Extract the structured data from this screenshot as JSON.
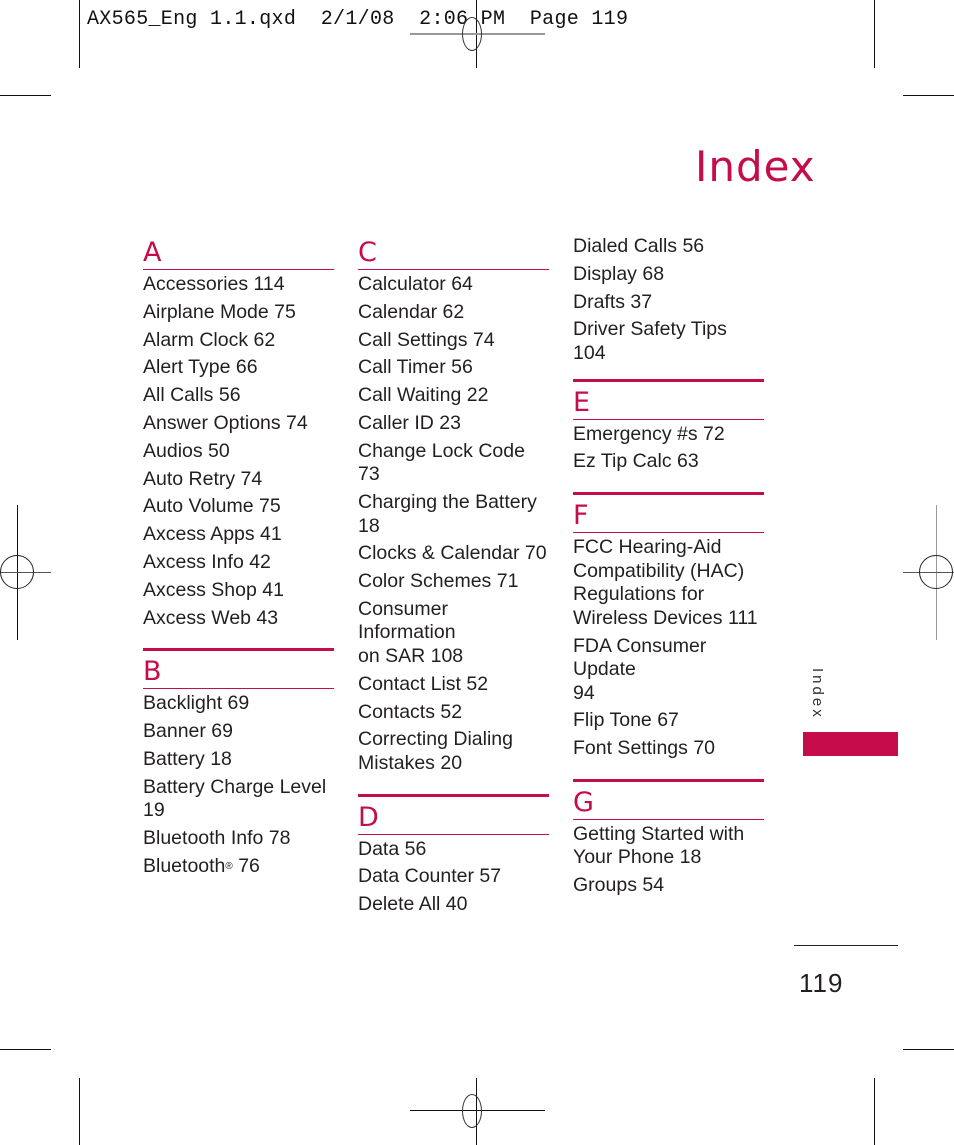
{
  "slug_line": "AX565_Eng 1.1.qxd  2/1/08  2:06 PM  Page 119",
  "title": "Index",
  "side_tab_label": "Index",
  "page_number": "119",
  "accent_color": "#c50d4c",
  "columns": [
    {
      "sections": [
        {
          "letter": "A",
          "entries": [
            "Accessories 114",
            "Airplane Mode 75",
            "Alarm Clock 62",
            "Alert Type 66",
            "All Calls 56",
            "Answer Options 74",
            "Audios 50",
            "Auto Retry 74",
            "Auto Volume 75",
            "Axcess Apps 41",
            "Axcess Info 42",
            "Axcess Shop 41",
            "Axcess Web 43"
          ]
        },
        {
          "letter": "B",
          "entries": [
            "Backlight 69",
            "Banner 69",
            "Battery 18",
            "Battery Charge Level\n19",
            "Bluetooth Info 78",
            "Bluetooth® 76"
          ]
        }
      ]
    },
    {
      "sections": [
        {
          "letter": "C",
          "entries": [
            "Calculator 64",
            "Calendar 62",
            "Call Settings 74",
            "Call Timer 56",
            "Call Waiting 22",
            "Caller ID 23",
            "Change Lock Code 73",
            "Charging the Battery\n18",
            "Clocks & Calendar 70",
            "Color Schemes 71",
            "Consumer Information\non SAR 108",
            "Contact List 52",
            "Contacts 52",
            "Correcting Dialing\nMistakes 20"
          ]
        },
        {
          "letter": "D",
          "entries": [
            "Data 56",
            "Data Counter 57",
            "Delete All 40"
          ]
        }
      ]
    },
    {
      "continued_entries": [
        "Dialed Calls 56",
        "Display 68",
        "Drafts 37",
        "Driver Safety Tips 104"
      ],
      "sections": [
        {
          "letter": "E",
          "entries": [
            "Emergency #s 72",
            "Ez Tip Calc 63"
          ]
        },
        {
          "letter": "F",
          "entries": [
            "FCC Hearing-Aid\nCompatibility (HAC)\nRegulations for\nWireless Devices 111",
            "FDA Consumer Update\n94",
            "Flip Tone 67",
            "Font Settings 70"
          ]
        },
        {
          "letter": "G",
          "entries": [
            "Getting Started with\nYour Phone 18",
            "Groups 54"
          ]
        }
      ]
    }
  ]
}
